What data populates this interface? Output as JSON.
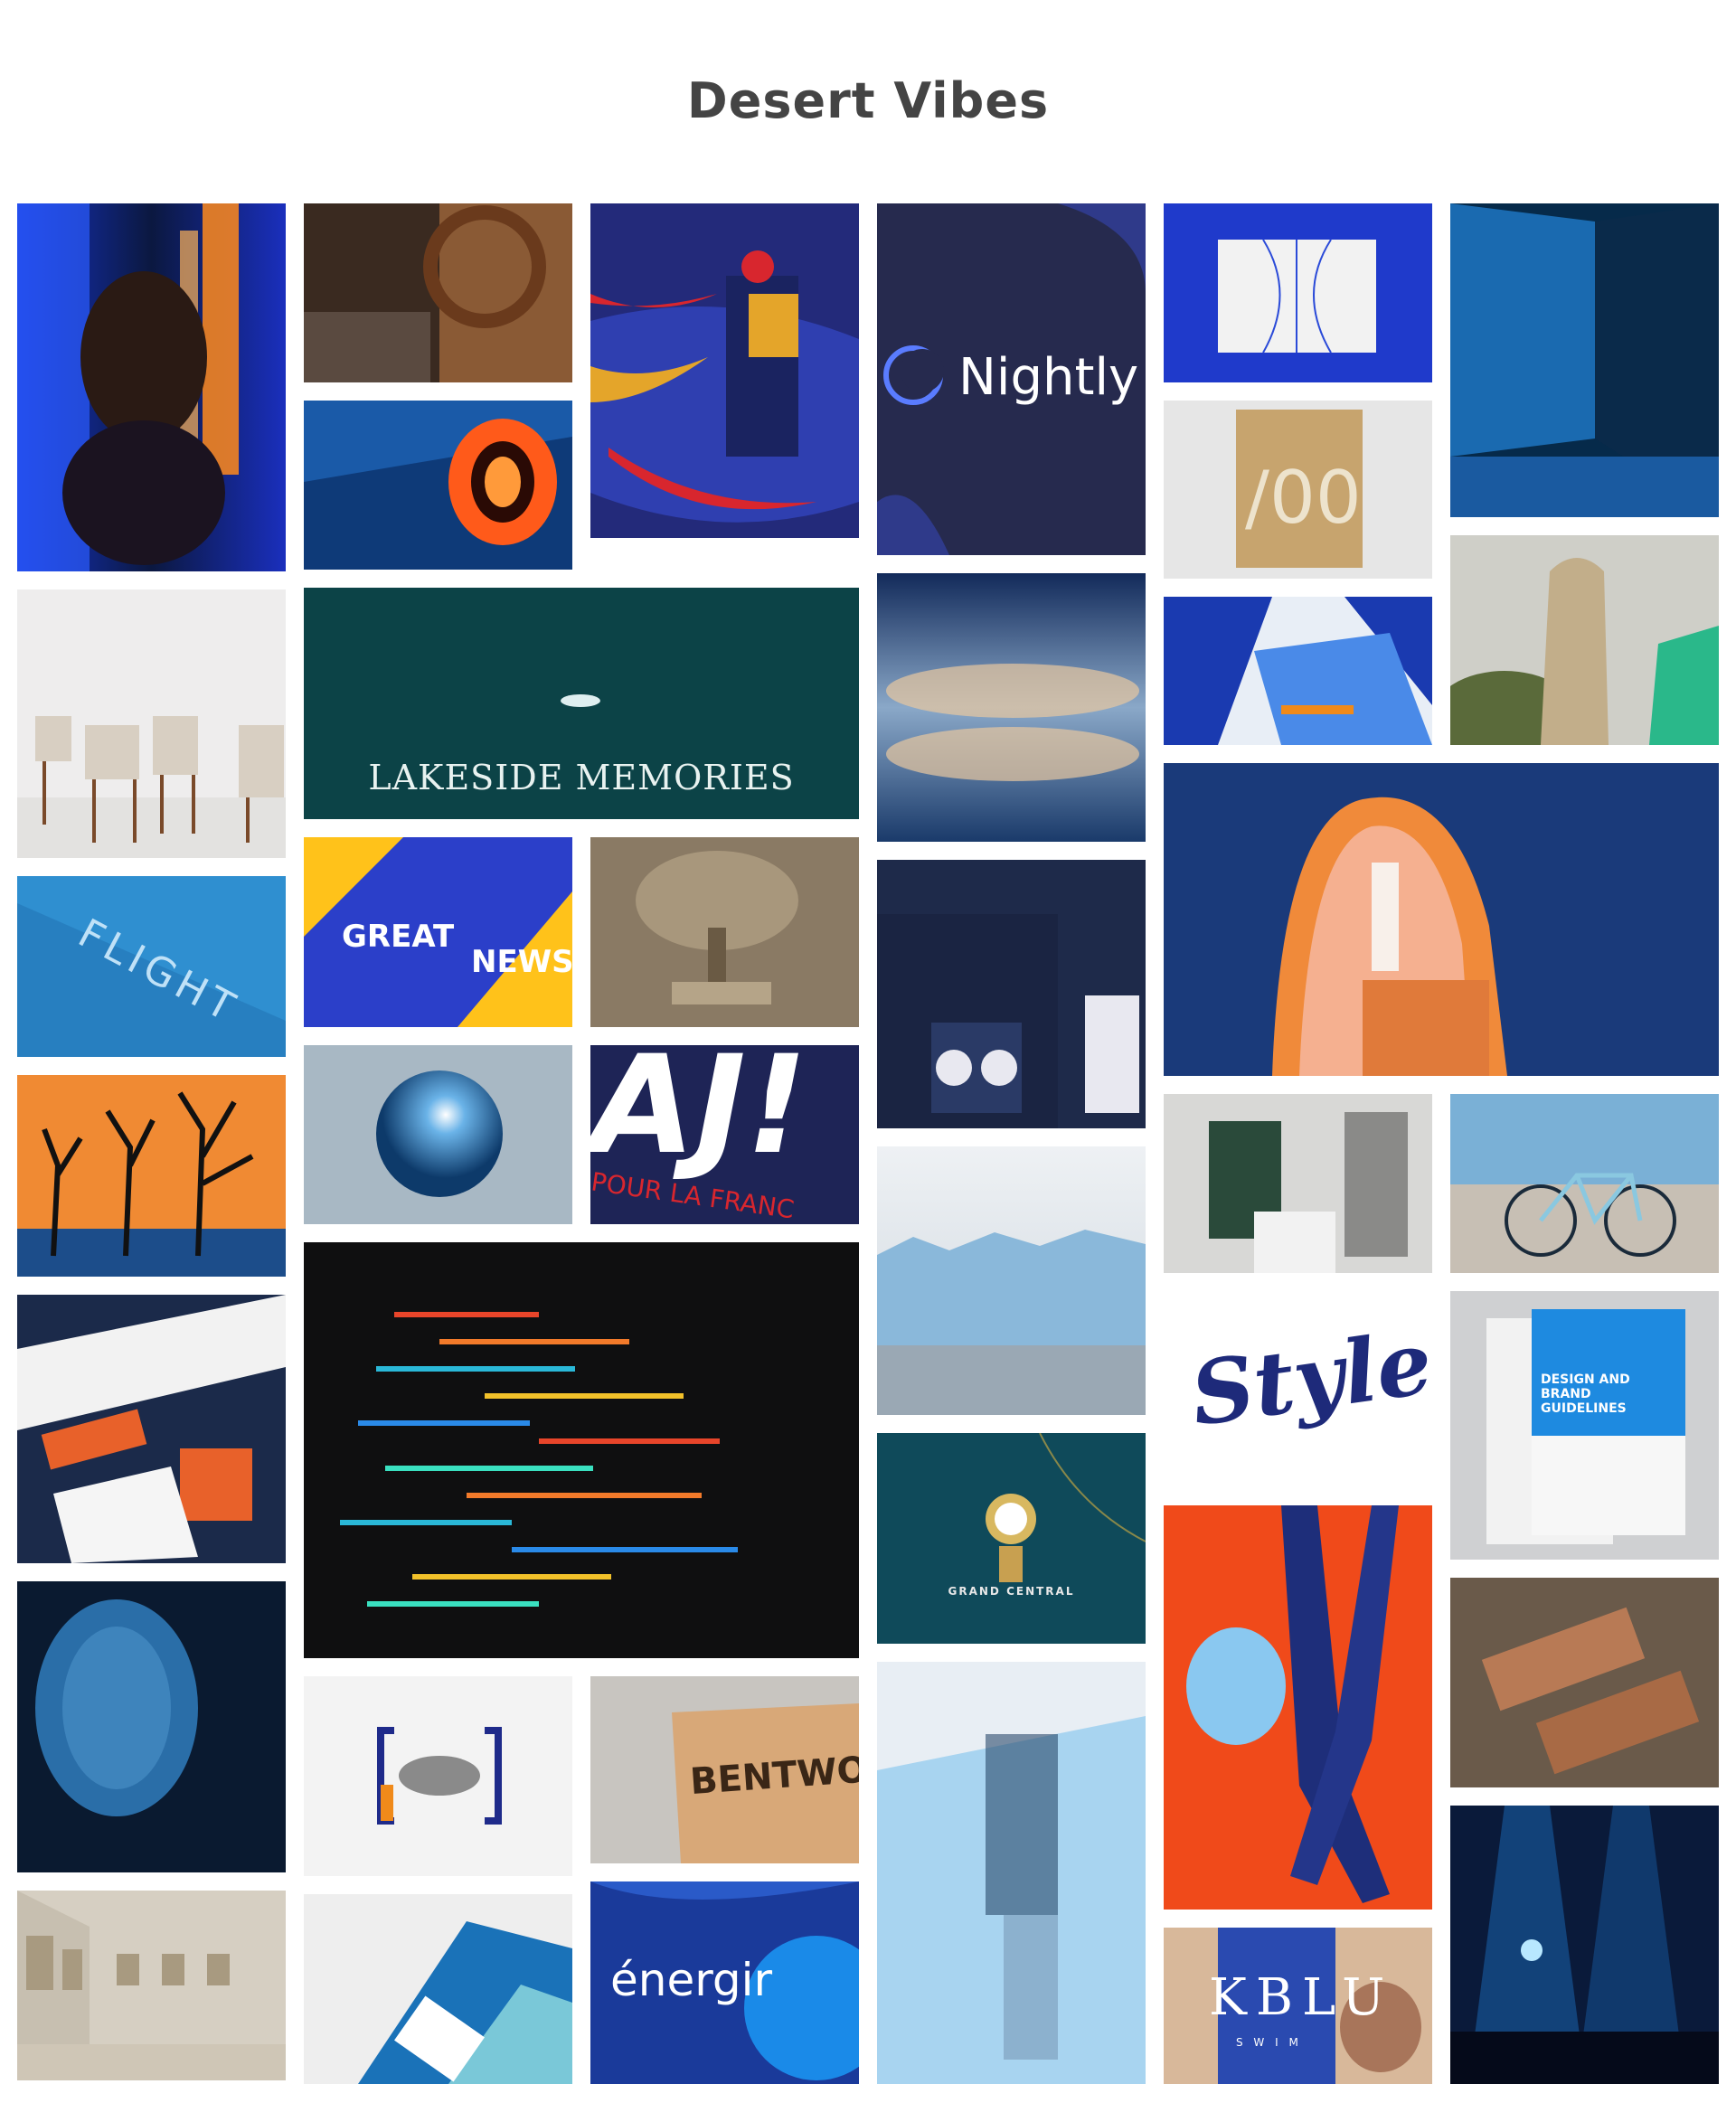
{
  "board": {
    "title": "Desert Vibes"
  },
  "tiles": {
    "nightly": {
      "text": "Nightly"
    },
    "lakeside": {
      "text": "LAKESIDE MEMORIES"
    },
    "flight": {
      "text": "FLIGHT"
    },
    "great_news": {
      "line1": "GREAT",
      "line2": "NEWS"
    },
    "aj": {
      "text": "AJ!",
      "sub": "POUR LA FRANC"
    },
    "grand_central": {
      "text": "GRAND CENTRAL"
    },
    "style": {
      "text": "Style"
    },
    "guidelines": {
      "text": "DESIGN AND BRAND GUIDELINES"
    },
    "bentwood": {
      "text": "BENTWOOD"
    },
    "energir": {
      "text": "énergir"
    },
    "kblu": {
      "text": "KBLU",
      "sub": "S W I M"
    }
  },
  "colors": {
    "accent_blue": "#2a3bb5",
    "navy": "#1f2547",
    "orange": "#f08a33",
    "title_gray": "#444444"
  }
}
